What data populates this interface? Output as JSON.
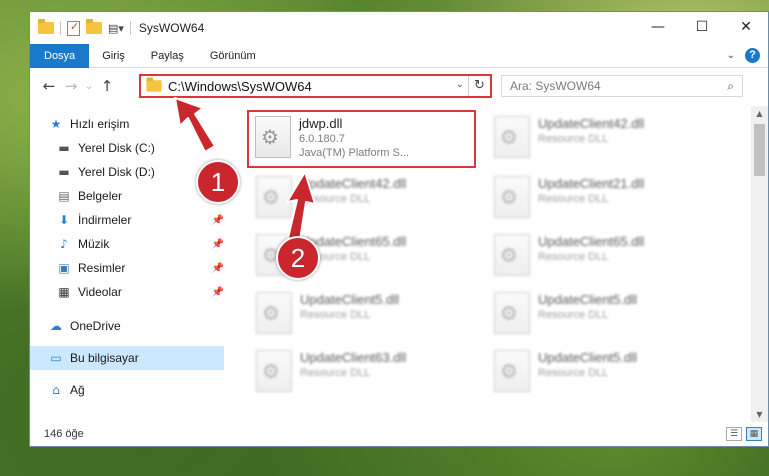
{
  "window": {
    "title": "SysWOW64"
  },
  "window_buttons": {
    "minimize": "—",
    "maximize": "☐",
    "close": "✕"
  },
  "ribbon": {
    "tabs": [
      "Dosya",
      "Giriş",
      "Paylaş",
      "Görünüm"
    ],
    "help": "?"
  },
  "address": {
    "path": "C:\\Windows\\SysWOW64"
  },
  "search": {
    "placeholder": "Ara: SysWOW64"
  },
  "sidebar": {
    "items": [
      {
        "label": "Hızlı erişim",
        "icon": "star-icon",
        "glyph": "★"
      },
      {
        "label": "Yerel Disk (C:)",
        "icon": "drive-icon",
        "glyph": "▬"
      },
      {
        "label": "Yerel Disk (D:)",
        "icon": "drive-icon",
        "glyph": "▬"
      },
      {
        "label": "Belgeler",
        "icon": "document-icon",
        "glyph": "▤"
      },
      {
        "label": "İndirmeler",
        "icon": "download-icon",
        "glyph": "⬇"
      },
      {
        "label": "Müzik",
        "icon": "music-icon",
        "glyph": "♪"
      },
      {
        "label": "Resimler",
        "icon": "picture-icon",
        "glyph": "▣"
      },
      {
        "label": "Videolar",
        "icon": "video-icon",
        "glyph": "▦"
      },
      {
        "label": "OneDrive",
        "icon": "cloud-icon",
        "glyph": "☁"
      },
      {
        "label": "Bu bilgisayar",
        "icon": "computer-icon",
        "glyph": "▭"
      },
      {
        "label": "Ağ",
        "icon": "network-icon",
        "glyph": "⌂"
      }
    ]
  },
  "files": [
    {
      "name": "jdwp.dll",
      "line1": "6.0.180.7",
      "line2": "Java(TM) Platform S..."
    },
    {
      "name": "UpdateClient42.dll",
      "line1": "Resource DLL"
    },
    {
      "name": "UpdateClient42.dll",
      "line1": "Resource DLL"
    },
    {
      "name": "UpdateClient21.dll",
      "line1": "Resource DLL"
    },
    {
      "name": "UpdateClient65.dll",
      "line1": "Resource DLL"
    },
    {
      "name": "UpdateClient65.dll",
      "line1": "Resource DLL"
    },
    {
      "name": "UpdateClient5.dll",
      "line1": "Resource DLL"
    },
    {
      "name": "UpdateClient5.dll",
      "line1": "Resource DLL"
    },
    {
      "name": "UpdateClient63.dll",
      "line1": "Resource DLL"
    },
    {
      "name": "UpdateClient5.dll",
      "line1": "Resource DLL"
    }
  ],
  "status": {
    "count": "146 öğe"
  },
  "annotations": {
    "badge1": "1",
    "badge2": "2",
    "color": "#c9262e"
  }
}
